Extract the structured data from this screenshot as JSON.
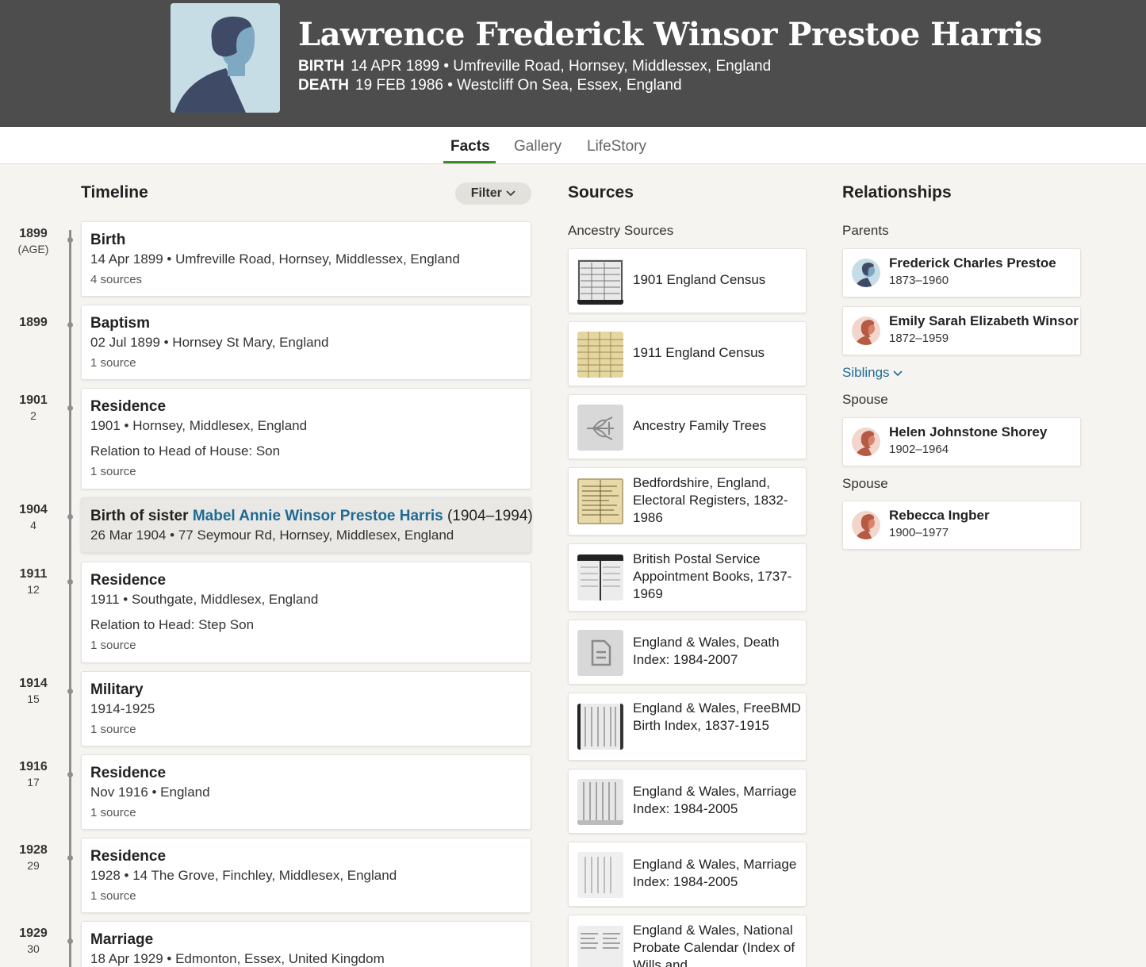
{
  "person": {
    "name": "Lawrence Frederick Winsor Prestoe Harris",
    "birth": {
      "label": "BIRTH",
      "value": "14 APR 1899 • Umfreville Road, Hornsey, Middlessex, England"
    },
    "death": {
      "label": "DEATH",
      "value": "19 FEB 1986 • Westcliff On Sea, Essex, England"
    }
  },
  "tabs": [
    {
      "label": "Facts",
      "active": true
    },
    {
      "label": "Gallery",
      "active": false
    },
    {
      "label": "LifeStory",
      "active": false
    }
  ],
  "timeline": {
    "title": "Timeline",
    "filter_label": "Filter",
    "events": [
      {
        "year": "1899",
        "age": "(AGE)",
        "title": "Birth",
        "detail": "14 Apr 1899 • Umfreville Road, Hornsey, Middlessex, England",
        "extra": "",
        "sources": "4 sources"
      },
      {
        "year": "1899",
        "age": "",
        "title": "Baptism",
        "detail": "02 Jul 1899 • Hornsey St Mary, England",
        "extra": "",
        "sources": "1 source"
      },
      {
        "year": "1901",
        "age": "2",
        "title": "Residence",
        "detail": "1901 • Hornsey, Middlesex, England",
        "extra": "Relation to Head of House: Son",
        "sources": "1 source"
      },
      {
        "year": "1904",
        "age": "4",
        "title_prefix": "Birth of sister",
        "title_link": "Mabel Annie Winsor Prestoe Harris",
        "title_span": "(1904–1994)",
        "detail": "26 Mar 1904 • 77 Seymour Rd, Hornsey, Middlesex, England"
      },
      {
        "year": "1911",
        "age": "12",
        "title": "Residence",
        "detail": "1911 • Southgate, Middlesex, England",
        "extra": "Relation to Head: Step Son",
        "sources": "1 source"
      },
      {
        "year": "1914",
        "age": "15",
        "title": "Military",
        "detail": "1914-1925",
        "extra": "",
        "sources": "1 source"
      },
      {
        "year": "1916",
        "age": "17",
        "title": "Residence",
        "detail": "Nov 1916 • England",
        "extra": "",
        "sources": "1 source"
      },
      {
        "year": "1928",
        "age": "29",
        "title": "Residence",
        "detail": "1928 • 14 The Grove, Finchley, Middlesex, England",
        "extra": "",
        "sources": "1 source"
      },
      {
        "year": "1929",
        "age": "30",
        "title": "Marriage",
        "detail": "18 Apr 1929 • Edmonton, Essex, United Kingdom",
        "extra": "",
        "sources": ""
      }
    ]
  },
  "sources": {
    "title": "Sources",
    "subtitle": "Ancestry Sources",
    "items": [
      {
        "label": "1901 England Census",
        "thumb": "census-scan"
      },
      {
        "label": "1911 England Census",
        "thumb": "census-scan-yellow"
      },
      {
        "label": "Ancestry Family Trees",
        "thumb": "tree-leaf-icon"
      },
      {
        "label": "Bedfordshire, England, Electoral Registers, 1832-1986",
        "thumb": "register-scan"
      },
      {
        "label": "British Postal Service Appointment Books, 1737-1969",
        "thumb": "book-scan"
      },
      {
        "label": "England & Wales, Death Index: 1984-2007",
        "thumb": "document-icon"
      },
      {
        "label": "England & Wales, FreeBMD Birth Index, 1837-1915",
        "thumb": "index-scan"
      },
      {
        "label": "England & Wales, Marriage Index: 1984-2005",
        "thumb": "index-scan"
      },
      {
        "label": "England & Wales, Marriage Index: 1984-2005",
        "thumb": "index-scan"
      },
      {
        "label": "England & Wales, National Probate Calendar (Index of Wills and",
        "thumb": "probate-scan"
      }
    ]
  },
  "relationships": {
    "title": "Relationships",
    "parents_label": "Parents",
    "parents": [
      {
        "name": "Frederick Charles Prestoe",
        "years": "1873–1960",
        "gender": "male"
      },
      {
        "name": "Emily Sarah Elizabeth Winsor",
        "years": "1872–1959",
        "gender": "female"
      }
    ],
    "siblings_label": "Siblings",
    "spouse_label_1": "Spouse",
    "spouse_1": {
      "name": "Helen Johnstone Shorey",
      "years": "1902–1964",
      "gender": "female"
    },
    "spouse_label_2": "Spouse",
    "spouse_2": {
      "name": "Rebecca Ingber",
      "years": "1900–1977",
      "gender": "female"
    }
  },
  "colors": {
    "header_bg": "#4d4d4d",
    "tab_accent": "#3c8a2e",
    "link": "#1e6a94",
    "female_avatar": "#d9836a",
    "male_avatar": "#5a7a99"
  }
}
